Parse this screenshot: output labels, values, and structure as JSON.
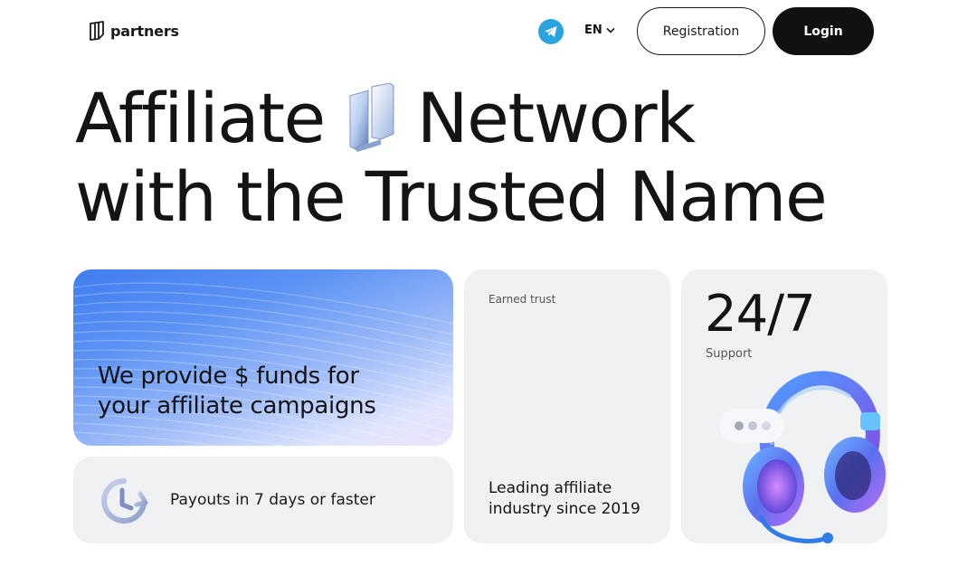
{
  "header": {
    "logo_text": "partners",
    "language": "EN",
    "registration_label": "Registration",
    "login_label": "Login"
  },
  "hero": {
    "line1_part1": "Affiliate",
    "line1_part2": "Network",
    "line2": "with the Trusted Name"
  },
  "cards": {
    "funds": {
      "text_line1": "We provide $ funds for",
      "text_line2": "your affiliate campaigns"
    },
    "payouts": {
      "text": "Payouts in 7 days or faster"
    },
    "trust": {
      "label": "Earned trust",
      "text_line1": "Leading affiliate",
      "text_line2": "industry since 2019"
    },
    "support": {
      "big": "24/7",
      "label": "Support"
    }
  },
  "colors": {
    "accent_blue": "#2aa3df",
    "dark": "#111111",
    "card_bg": "#eff1f3"
  },
  "icons": [
    "logo-icon",
    "telegram-icon",
    "chevron-down-icon",
    "clock-icon",
    "headphones-icon",
    "chat-bubble-icon"
  ]
}
